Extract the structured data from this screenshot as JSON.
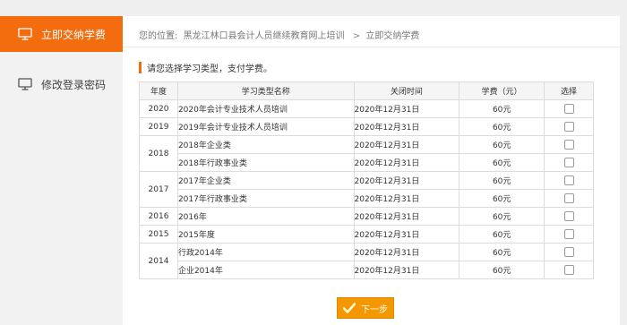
{
  "sidebar": {
    "items": [
      {
        "label": "立即交纳学费",
        "icon": "monitor-icon",
        "active": true
      },
      {
        "label": "修改登录密码",
        "icon": "monitor-icon",
        "active": false
      }
    ]
  },
  "breadcrumb": {
    "prefix": "您的位置:",
    "site": "黑龙江林口县会计人员继续教育网上培训",
    "separator": ">",
    "current": "立即交纳学费"
  },
  "section_title": "请您选择学习类型，支付学费。",
  "table": {
    "headers": [
      "年度",
      "学习类型名称",
      "关闭时间",
      "学费（元）",
      "选择"
    ],
    "groups": [
      {
        "year": "2020",
        "rows": [
          {
            "name": "2020年会计专业技术人员培训",
            "close": "2020年12月31日",
            "fee": "60元"
          }
        ]
      },
      {
        "year": "2019",
        "rows": [
          {
            "name": "2019年会计专业技术人员培训",
            "close": "2020年12月31日",
            "fee": "60元"
          }
        ]
      },
      {
        "year": "2018",
        "rows": [
          {
            "name": "2018年企业类",
            "close": "2020年12月31日",
            "fee": "60元"
          },
          {
            "name": "2018年行政事业类",
            "close": "2020年12月31日",
            "fee": "60元"
          }
        ]
      },
      {
        "year": "2017",
        "rows": [
          {
            "name": "2017年企业类",
            "close": "2020年12月31日",
            "fee": "60元"
          },
          {
            "name": "2017年行政事业类",
            "close": "2020年12月31日",
            "fee": "60元"
          }
        ]
      },
      {
        "year": "2016",
        "rows": [
          {
            "name": "2016年",
            "close": "2020年12月31日",
            "fee": "60元"
          }
        ]
      },
      {
        "year": "2015",
        "rows": [
          {
            "name": "2015年度",
            "close": "2020年12月31日",
            "fee": "60元"
          }
        ]
      },
      {
        "year": "2014",
        "rows": [
          {
            "name": "行政2014年",
            "close": "2020年12月31日",
            "fee": "60元"
          },
          {
            "name": "企业2014年",
            "close": "2020年12月31日",
            "fee": "60元"
          }
        ]
      }
    ]
  },
  "next_button": {
    "label": "下一步",
    "icon": "check-icon"
  },
  "colors": {
    "accent": "#f36d0f",
    "button": "#f39800"
  }
}
